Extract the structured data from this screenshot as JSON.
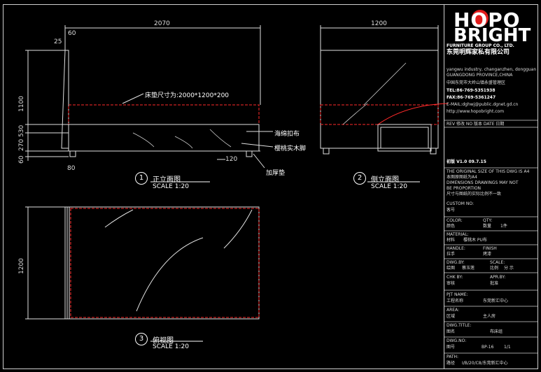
{
  "colors": {
    "background": "#000000",
    "line": "#e0e0e0",
    "cut": "#ff2a2a",
    "logo_circle": "#e01b1b"
  },
  "dims": {
    "overall_width": "2070",
    "headboard_top": "60",
    "headboard_offset": "25",
    "height_total": "1100",
    "height_mid": "530",
    "height_low": "270",
    "height_foot": "60",
    "foot_80": "80",
    "foot_120": "120",
    "side_width": "1200",
    "top_depth": "1200"
  },
  "labels": {
    "mattress_size": "床垫尺寸为:2000*1200*200",
    "fabric": "海绵扣布",
    "wood_foot": "樱桃实木脚",
    "bolster": "加厚垫"
  },
  "views": [
    {
      "num": "1",
      "title": "正立面图",
      "scale": "SCALE 1:20"
    },
    {
      "num": "2",
      "title": "侧立面图",
      "scale": "SCALE 1:20"
    },
    {
      "num": "3",
      "title": "俯视图",
      "scale": "SCALE 1:20"
    }
  ],
  "title_block": {
    "logo_line1": "HOPO",
    "logo_line2": "BRIGHT",
    "company_en": "FURNITURE GROUP CO., LTD.",
    "company_cn": "东莞明辉家私有限公司",
    "addr_en1": "yangwu industry, changanzhen, dongguan",
    "addr_en2": "GUANGDONG PROVINCE,CHINA",
    "addr_cn": "中国东莞市大岭山镇永盛管理区",
    "tel": "TEL:86-769-5351938",
    "fax": "FAX:86-769-5361247",
    "email": "E-MAIL:dghwj@public.dgnet.gd.cn",
    "web": "http://www.hopobright.com",
    "rev_head": "REV 修改   NO 版本   DATE 日期",
    "rev_row": "初版   V1.0   09.7.15",
    "note1": "THE ORIGINAL SIZE OF THIS DWG IS A4",
    "note2": "本图原图纸为A4",
    "note3": "DIMENSIONS DRAWINGS MAY NOT",
    "note4": "BE PROPORTION",
    "note5": "尺寸与图纸的实际比例不一致",
    "custom_no_label": "CUSTOM NO:",
    "custom_no_cn": "客号",
    "color_label": "COLOR:",
    "color_cn": "颜色",
    "qty_label": "QTY:",
    "qty_cn": "数量",
    "qty_val": "1件",
    "material_label": "MATERIAL:",
    "material_cn": "材料",
    "material_val": "樱桃木   PU布",
    "handle_label": "HANDLE:",
    "handle_cn": "拉手",
    "finish_label": "FINISH",
    "finish_val": "烤漆",
    "dwg_label": "DWG.BY:",
    "dwg_cn": "绘图",
    "dwg_val": "蔡玉莲",
    "scale_label": "SCALE:",
    "scale_cn": "比例",
    "scale_val": "分  示",
    "chk_label": "CHK BY:",
    "chk_cn": "审核",
    "apr_label": "APR.BY:",
    "apr_val": "批准",
    "prj_label": "PJT NAME:",
    "prj_cn": "工程名称",
    "prj_val": "东莞新汇中心",
    "area_label": "AREA:",
    "area_cn": "区域",
    "area_val": "主人房",
    "title_label": "DWG.TITLE:",
    "title_cn": "图名",
    "title_val": "布床组",
    "dwgno_label": "DWG.NO:",
    "dwgno_cn": "图号",
    "dwgno_val": "BP-16",
    "sheet": "1/1",
    "path_label": "PATH:",
    "path_cn": "路径",
    "path_val": "I/B/20/C8/东莞新汇中心"
  }
}
